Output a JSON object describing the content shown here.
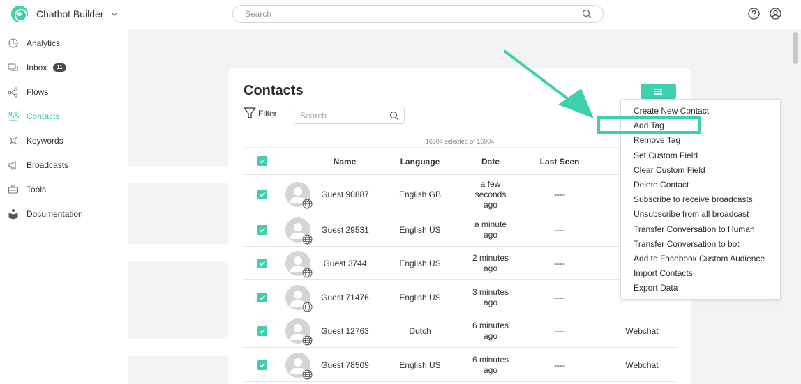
{
  "app": {
    "name": "Chatbot Builder"
  },
  "top_search": {
    "placeholder": "Search"
  },
  "sidebar": {
    "items": [
      {
        "label": "Analytics",
        "icon": "analytics-icon"
      },
      {
        "label": "Inbox",
        "icon": "inbox-icon",
        "badge": "11"
      },
      {
        "label": "Flows",
        "icon": "flows-icon"
      },
      {
        "label": "Contacts",
        "icon": "contacts-icon",
        "active": true
      },
      {
        "label": "Keywords",
        "icon": "keywords-icon"
      },
      {
        "label": "Broadcasts",
        "icon": "broadcasts-icon"
      },
      {
        "label": "Tools",
        "icon": "tools-icon"
      },
      {
        "label": "Documentation",
        "icon": "documentation-icon"
      }
    ]
  },
  "contacts": {
    "title": "Contacts",
    "filter_label": "Filter",
    "search_placeholder": "Search",
    "selected_text": "16904 selected of 16904",
    "columns": [
      "Name",
      "Language",
      "Date",
      "Last Seen"
    ],
    "rows": [
      {
        "name": "Guest 90887",
        "language": "English GB",
        "date": [
          "a few",
          "seconds",
          "ago"
        ],
        "last_seen": "----",
        "channel": ""
      },
      {
        "name": "Guest 29531",
        "language": "English US",
        "date": [
          "a minute",
          "ago"
        ],
        "last_seen": "----",
        "channel": ""
      },
      {
        "name": "Guest 3744",
        "language": "English US",
        "date": [
          "2 minutes",
          "ago"
        ],
        "last_seen": "----",
        "channel": ""
      },
      {
        "name": "Guest 71476",
        "language": "English US",
        "date": [
          "3 minutes",
          "ago"
        ],
        "last_seen": "----",
        "channel": "Webchat"
      },
      {
        "name": "Guest 12763",
        "language": "Dutch",
        "date": [
          "6 minutes",
          "ago"
        ],
        "last_seen": "----",
        "channel": "Webchat"
      },
      {
        "name": "Guest 78509",
        "language": "English US",
        "date": [
          "6 minutes",
          "ago"
        ],
        "last_seen": "----",
        "channel": "Webchat"
      }
    ]
  },
  "actions_menu": {
    "items": [
      "Create New Contact",
      "Add Tag",
      "Remove Tag",
      "Set Custom Field",
      "Clear Custom Field",
      "Delete Contact",
      "Subscribe to receive broadcasts",
      "Unsubscribe from all broadcast",
      "Transfer Conversation to Human",
      "Transfer Conversation to bot",
      "Add to Facebook Custom Audience",
      "Import Contacts",
      "Export Data"
    ],
    "highlighted": "Add Tag"
  },
  "colors": {
    "accent": "#3ecfae",
    "active_text": "#37c9a7"
  }
}
